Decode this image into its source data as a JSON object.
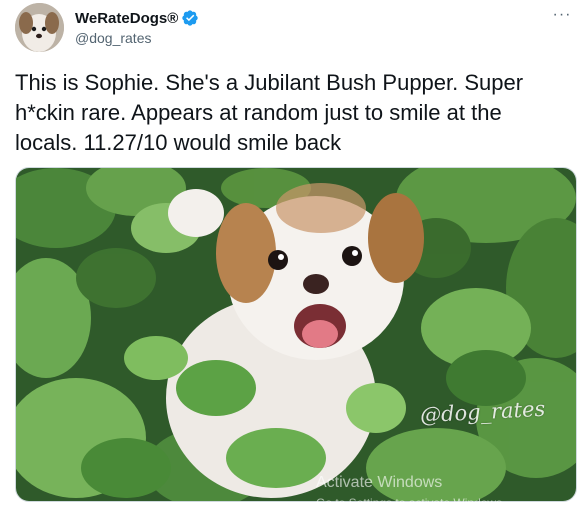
{
  "tweet": {
    "author": {
      "display_name": "WeRateDogs®",
      "handle": "@dog_rates",
      "verified": true
    },
    "text": "This is Sophie. She's a Jubilant Bush Pupper. Super h*ckin rare. Appears at random just to smile at the locals. 11.27/10 would smile back",
    "media": {
      "watermark": "@dog_rates"
    }
  },
  "overlay": {
    "activate_title": "Activate Windows",
    "activate_subtitle": "Go to Settings to activate Windows."
  },
  "colors": {
    "verified_blue": "#1d9bf0",
    "secondary_text": "#536471"
  },
  "icons": {
    "verified": "verified-badge-icon",
    "more": "more-options-icon"
  }
}
